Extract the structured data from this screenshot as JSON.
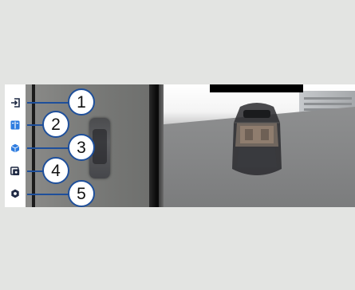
{
  "toolbar": {
    "items": [
      {
        "icon": "exit-icon",
        "color": "#1f2a44"
      },
      {
        "icon": "split-view-icon",
        "color": "#2f7de0"
      },
      {
        "icon": "3d-cube-icon",
        "color": "#2f7de0"
      },
      {
        "icon": "camera-view-icon",
        "color": "#1f2a44"
      },
      {
        "icon": "gear-icon",
        "color": "#1f2a44"
      }
    ]
  },
  "callouts": [
    "1",
    "2",
    "3",
    "4",
    "5"
  ],
  "colors": {
    "callout_border": "#1e4f9b",
    "background": "#e3e4e2"
  }
}
